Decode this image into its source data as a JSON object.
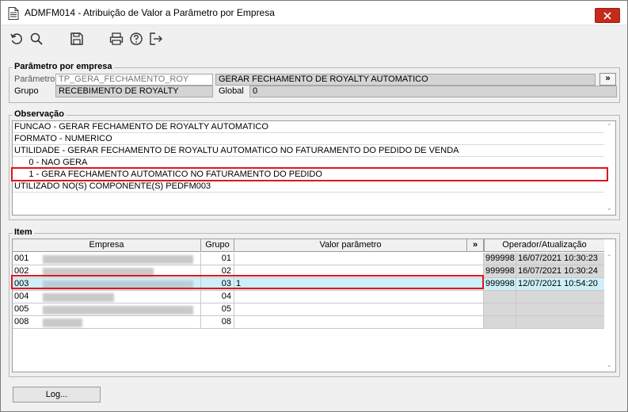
{
  "window": {
    "title": "ADMFM014 - Atribuição de Valor a Parâmetro por Empresa"
  },
  "toolbar": {
    "icons": [
      "refresh-icon",
      "search-icon",
      "save-icon",
      "print-icon",
      "help-icon",
      "exit-icon"
    ]
  },
  "param_section": {
    "legend": "Parâmetro por empresa",
    "parametro_label": "Parâmetro",
    "parametro_value": "TP_GERA_FECHAMENTO_ROY",
    "parametro_desc": "GERAR FECHAMENTO DE ROYALTY AUTOMATICO",
    "lookup_label": "»",
    "grupo_label": "Grupo",
    "grupo_value": "RECEBIMENTO DE ROYALTY",
    "global_label": "Global",
    "global_value": "0"
  },
  "observacao": {
    "legend": "Observação",
    "lines": [
      "FUNCAO - GERAR FECHAMENTO DE ROYALTY AUTOMATICO",
      "FORMATO - NUMERICO",
      "UTILIDADE - GERAR FECHAMENTO DE ROYALTU AUTOMATICO NO FATURAMENTO DO PEDIDO DE VENDA",
      "      0 - NAO GERA",
      "      1 - GERA FECHAMENTO AUTOMATICO NO FATURAMENTO DO PEDIDO",
      "UTILIZADO NO(S) COMPONENTE(S) PEDFM003"
    ]
  },
  "item": {
    "legend": "Item",
    "headers": {
      "empresa": "Empresa",
      "grupo": "Grupo",
      "valor": "Valor parâmetro",
      "expand": "»",
      "operador": "Operador/Atualização"
    },
    "rows": [
      {
        "codigo": "001",
        "grupo": "01",
        "valor": "",
        "operador": "999998",
        "atualizacao": "16/07/2021 10:30:23"
      },
      {
        "codigo": "002",
        "grupo": "02",
        "valor": "",
        "operador": "999998",
        "atualizacao": "16/07/2021 10:30:24"
      },
      {
        "codigo": "003",
        "grupo": "03",
        "valor": "1",
        "operador": "999998",
        "atualizacao": "12/07/2021 10:54:20"
      },
      {
        "codigo": "004",
        "grupo": "04",
        "valor": "",
        "operador": "",
        "atualizacao": ""
      },
      {
        "codigo": "005",
        "grupo": "05",
        "valor": "",
        "operador": "",
        "atualizacao": ""
      },
      {
        "codigo": "008",
        "grupo": "08",
        "valor": "",
        "operador": "",
        "atualizacao": ""
      }
    ]
  },
  "footer": {
    "log_button": "Log..."
  },
  "colors": {
    "selected_row": "#cdf0f8",
    "highlight_border": "#e0141e",
    "close_button": "#c42b1c"
  }
}
